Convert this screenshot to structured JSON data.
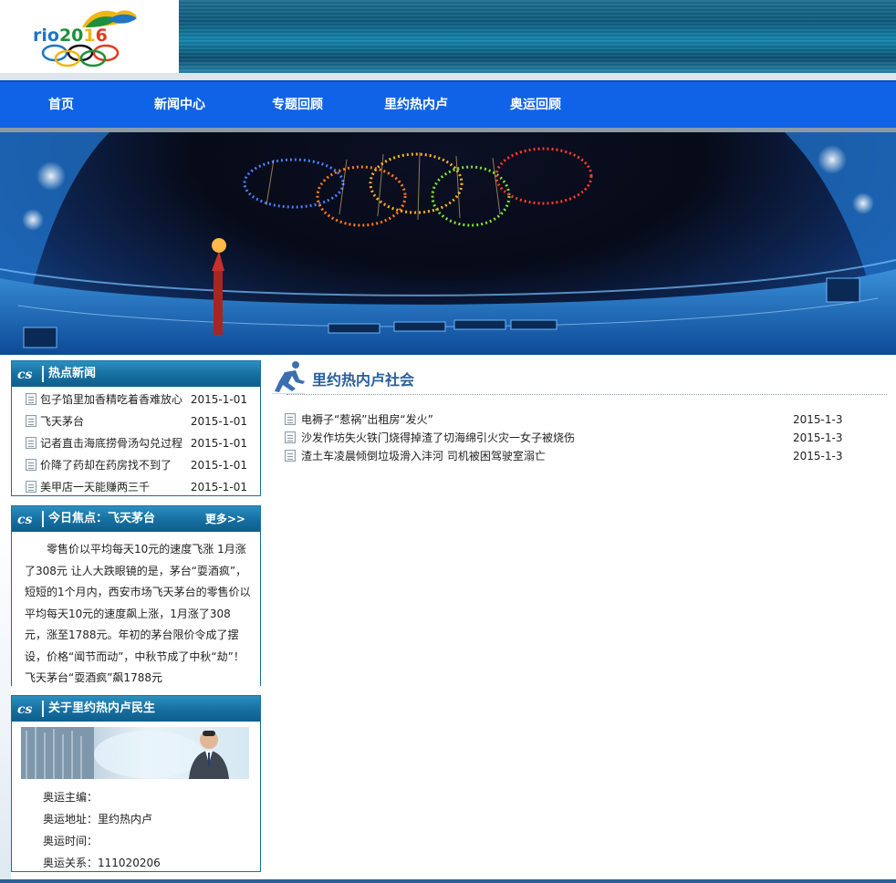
{
  "header": {
    "logo_text": "rio2016",
    "colors": {
      "band": "#0e5a7c",
      "nav": "#1063e6",
      "panel": "#156e9f",
      "title": "#2a5f9a"
    }
  },
  "nav": {
    "items": [
      {
        "label": "首页"
      },
      {
        "label": "新闻中心"
      },
      {
        "label": "专题回顾"
      },
      {
        "label": "里约热内卢"
      },
      {
        "label": "奥运回顾"
      }
    ]
  },
  "hot_news": {
    "title": "热点新闻",
    "items": [
      {
        "title": "包子馅里加香精吃着香难放心",
        "date": "2015-1-01"
      },
      {
        "title": "飞天茅台",
        "date": "2015-1-01"
      },
      {
        "title": "记者直击海底捞骨汤勾兑过程",
        "date": "2015-1-01"
      },
      {
        "title": "价降了药却在药房找不到了",
        "date": "2015-1-01"
      },
      {
        "title": "美甲店一天能赚两三千",
        "date": "2015-1-01"
      }
    ]
  },
  "focus": {
    "title": "今日焦点：飞天茅台",
    "more": "更多>>",
    "text": "零售价以平均每天10元的速度飞涨 1月涨了308元 让人大跌眼镜的是，茅台“耍酒疯”，短短的1个月内，西安市场飞天茅台的零售价以平均每天10元的速度飙上涨，1月涨了308元，涨至1788元。年初的茅台限价令成了摆设，价格“闻节而动”，中秋节成了中秋“劫”！ 飞天茅台“耍酒疯”飙1788元"
  },
  "about": {
    "title": "关于里约热内卢民生",
    "rows": [
      {
        "label": "奥运主编：",
        "value": ""
      },
      {
        "label": "奥运地址：",
        "value": "里约热内卢"
      },
      {
        "label": "奥运时间：",
        "value": ""
      },
      {
        "label": "奥运关系：",
        "value": "111020206"
      }
    ]
  },
  "society": {
    "title": "里约热内卢社会",
    "items": [
      {
        "title": "电褥子“惹祸”出租房“发火”",
        "date": "2015-1-3"
      },
      {
        "title": "沙发作坊失火铁门烧得掉渣了切海绵引火灾一女子被烧伤",
        "date": "2015-1-3"
      },
      {
        "title": "渣土车凌晨倾倒垃圾滑入沣河 司机被困驾驶室溺亡",
        "date": "2015-1-3"
      }
    ]
  }
}
